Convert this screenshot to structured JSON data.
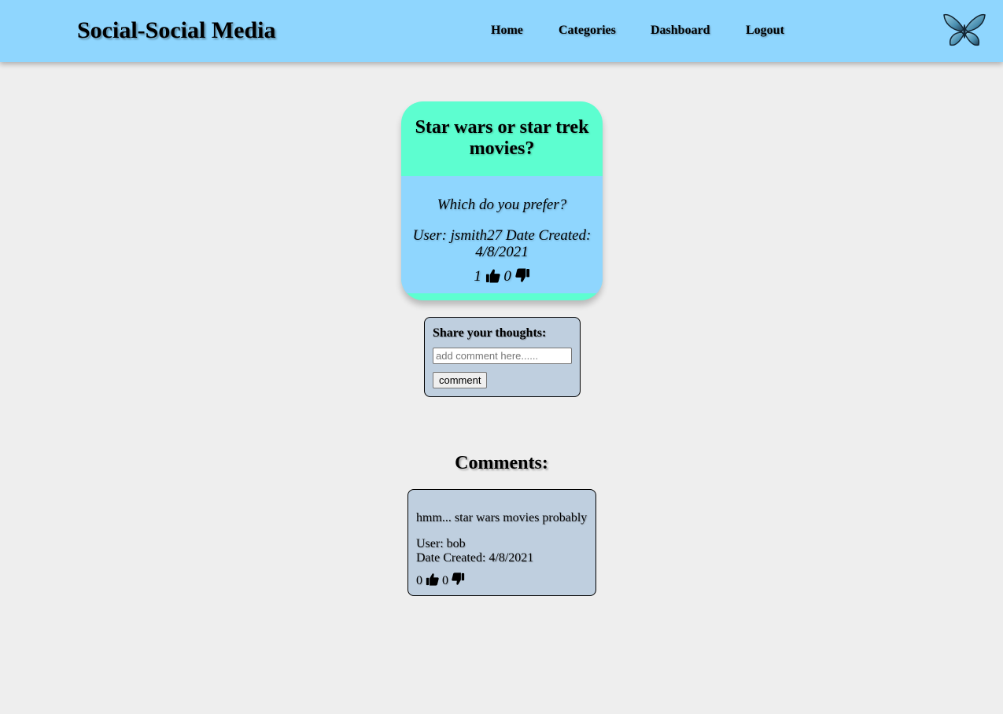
{
  "header": {
    "brand": "Social-Social Media",
    "nav": [
      {
        "label": "Home"
      },
      {
        "label": "Categories"
      },
      {
        "label": "Dashboard"
      },
      {
        "label": "Logout"
      }
    ],
    "logo_icon": "butterfly-icon"
  },
  "post": {
    "title": "Star wars or star trek movies?",
    "question": "Which do you prefer?",
    "meta_line1": "User: jsmith27 Date Created:",
    "meta_line2": "4/8/2021",
    "likes": "1",
    "dislikes": "0"
  },
  "comment_form": {
    "label": "Share your thoughts:",
    "placeholder": "add comment here......",
    "button_label": "comment"
  },
  "comments": {
    "heading": "Comments:",
    "items": [
      {
        "text": "hmm... star wars movies probably",
        "user": "User: bob",
        "date": "Date Created: 4/8/2021",
        "likes": "0",
        "dislikes": "0"
      }
    ]
  },
  "colors": {
    "navbar": "#8fd6fe",
    "post_header": "#5dfed0",
    "post_body": "#8fd6fe",
    "panel": "#bfcfdf",
    "page_bg": "#eeeeee"
  }
}
